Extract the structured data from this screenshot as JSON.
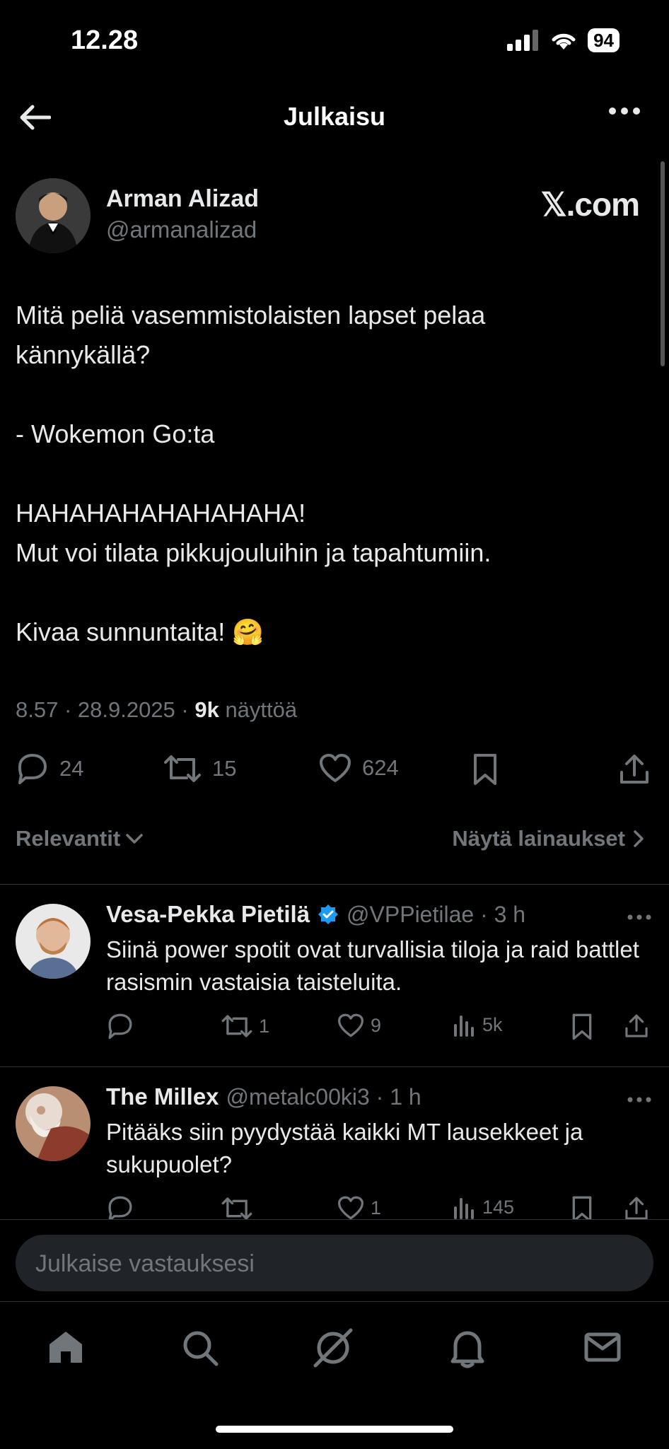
{
  "status_bar": {
    "time": "12.28",
    "battery": "94"
  },
  "header": {
    "title": "Julkaisu"
  },
  "tweet": {
    "author_name": "Arman Alizad",
    "author_handle": "@armanalizad",
    "source_label": "𝕏.com",
    "text": "Mitä peliä vasemmistolaisten lapset pelaa\nkännykällä?\n\n- Wokemon Go:ta\n\nHAHAHAHAHAHAHAHA!\nMut voi tilata pikkujouluihin ja tapahtumiin.\n\nKivaa sunnuntaita! 🤗",
    "time_date": "8.57 · 28.9.2025 · ",
    "views_count": "9k",
    "views_label": " näyttöä",
    "reply_count": "24",
    "retweet_count": "15",
    "like_count": "624"
  },
  "sort": {
    "relevance_label": "Relevantit",
    "quotes_label": "Näytä lainaukset"
  },
  "replies": [
    {
      "name": "Vesa-Pekka Pietilä",
      "handle_time": "@VPPietilae · 3 h",
      "text": "Siinä power spotit ovat turvallisia tiloja ja raid battlet rasismin vastaisia taisteluita.",
      "reply_count": "",
      "retweet_count": "1",
      "like_count": "9",
      "view_count": "5k"
    },
    {
      "name": "The Millex",
      "handle_time": "@metalc00ki3 · 1 h",
      "text": "Pitääks siin pyydystää kaikki MT lausekkeet ja sukupuolet?",
      "reply_count": "",
      "retweet_count": "",
      "like_count": "1",
      "view_count": "145"
    }
  ],
  "composer": {
    "placeholder": "Julkaise vastauksesi"
  },
  "colors": {
    "background": "#000000",
    "text": "#e7e9ea",
    "muted": "#71767b",
    "verified": "#1d9bf0"
  }
}
